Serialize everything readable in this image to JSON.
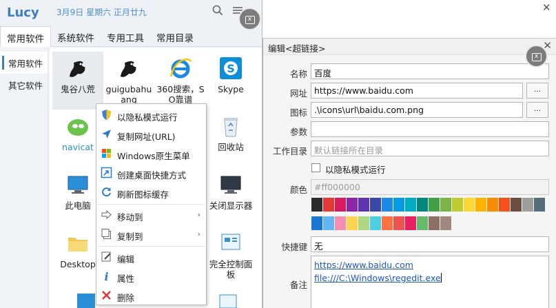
{
  "lucy": {
    "app_name": "Lucy",
    "date_text": "3月9日 星期六 正月廿九",
    "tabs": [
      "常用软件",
      "系统软件",
      "专用工具",
      "常用目录"
    ],
    "side_items": [
      "常用软件",
      "其它软件"
    ],
    "tiles": [
      {
        "label": "鬼谷八荒",
        "icon": "dragon-icon"
      },
      {
        "label": "guigubahuang",
        "icon": "dragon-icon"
      },
      {
        "label": "360搜索，SO靠谱",
        "icon": "ie-icon"
      },
      {
        "label": "Skype",
        "icon": "skype-icon"
      },
      {
        "label": "navicat",
        "icon": "navicat-icon"
      },
      {
        "label": "回收站",
        "icon": "recycle-bin-icon"
      },
      {
        "label": "此电脑",
        "icon": "computer-icon"
      },
      {
        "label": "关闭显示器",
        "icon": "monitor-off-icon"
      },
      {
        "label": "Desktop",
        "icon": "folder-icon"
      },
      {
        "label": "完全控制面板",
        "icon": "control-panel-icon"
      }
    ]
  },
  "context_menu": {
    "items": [
      {
        "label": "以隐私模式运行",
        "icon": "shield-icon"
      },
      {
        "label": "复制网址(URL)",
        "icon": "send-arrow-icon"
      },
      {
        "label": "Windows原生菜单",
        "icon": "windows-logo-icon"
      },
      {
        "label": "创建桌面快捷方式",
        "icon": "shortcut-icon"
      },
      {
        "label": "刷新图标缓存",
        "icon": "refresh-icon"
      },
      {
        "label": "移动到",
        "icon": "move-icon"
      },
      {
        "label": "复制到",
        "icon": "copy-icon"
      },
      {
        "label": "编辑",
        "icon": "edit-icon"
      },
      {
        "label": "属性",
        "icon": "info-icon"
      },
      {
        "label": "删除",
        "icon": "delete-icon"
      }
    ]
  },
  "editor": {
    "title": "编辑<超链接>",
    "fields": {
      "name_label": "名称",
      "name_value": "百度",
      "url_label": "网址",
      "url_value": "https://www.baidu.com",
      "icon_label": "图标",
      "icon_value": ".\\icons\\url\\baidu.com.png",
      "params_label": "参数",
      "params_value": "",
      "workdir_label": "工作目录",
      "workdir_placeholder": "默认链接所在目录",
      "private_label": "以隐私模式运行",
      "color_label": "颜色",
      "color_value": "#ff000000",
      "hotkey_label": "快捷键",
      "hotkey_value": "无",
      "note_label": "备注",
      "note_lines": [
        "https://www.baidu.com",
        "file:///C:\\Windows\\regedit.exe"
      ]
    },
    "browse_label": "...",
    "palette_row1": [
      "#2b2b2b",
      "#e53935",
      "#d81b60",
      "#8e24aa",
      "#5e35b1",
      "#3949ab",
      "#1e88e5",
      "#039be5",
      "#00acc1",
      "#00897b",
      "#43a047",
      "#7cb342",
      "#c0ca33",
      "#fdd835",
      "#ffb300",
      "#fb8c00",
      "#f4511e",
      "#6d4c41",
      "#9e9e9e",
      "#546e7a"
    ],
    "palette_row2": [
      "#1976d2",
      "#64b5f6",
      "#f48fb1",
      "#ffd54f",
      "#aed581",
      "#4dd0e1",
      "#ff7043",
      "#ef5350",
      "#e91e63",
      "#66bb6a",
      "#8d6e63",
      "#a1887f"
    ]
  }
}
